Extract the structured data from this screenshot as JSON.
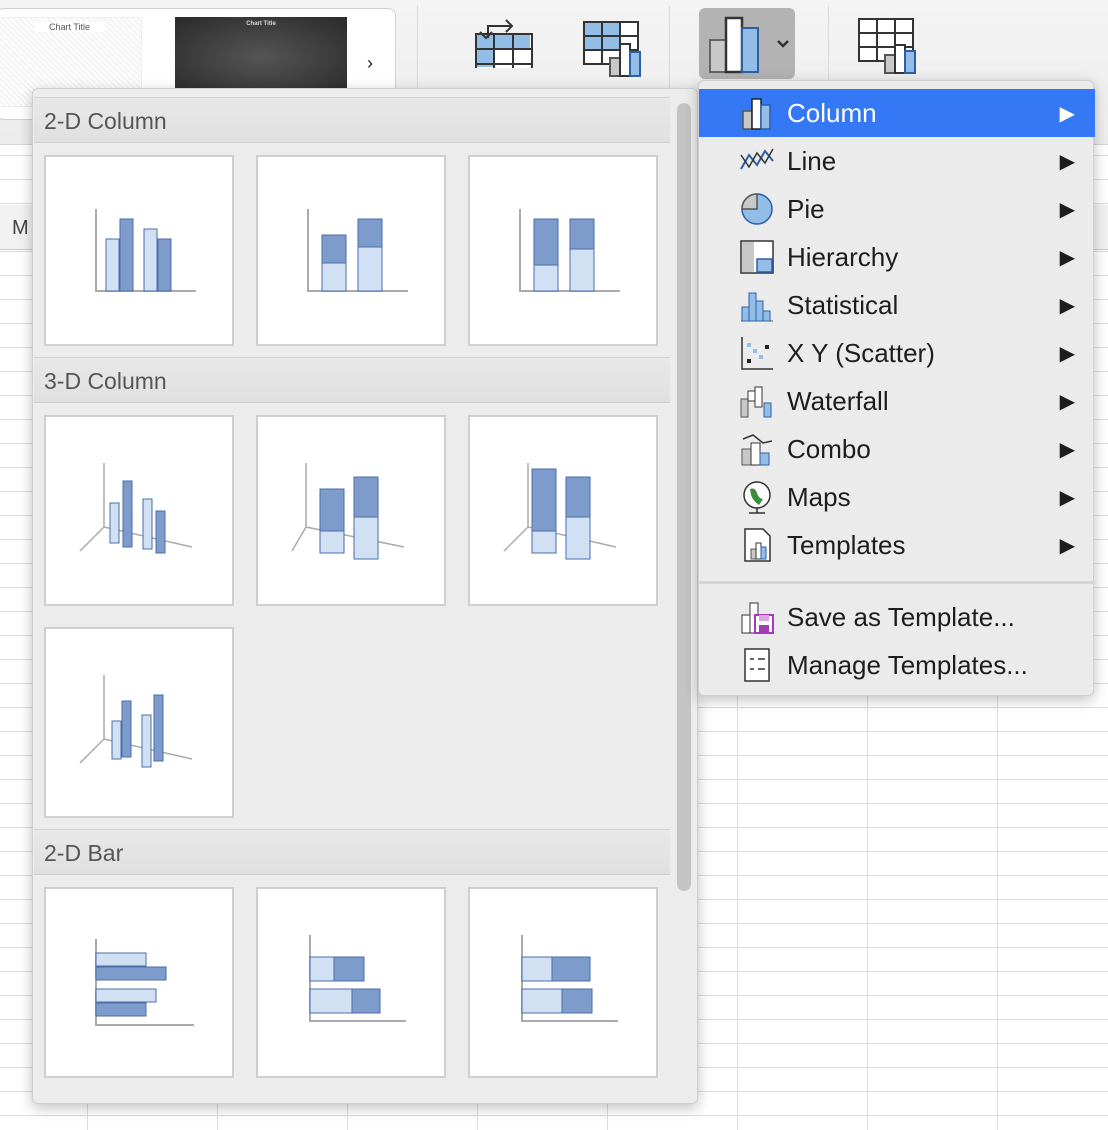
{
  "ribbon": {
    "style_gallery": {
      "thumbs": [
        {
          "title": "Chart Title"
        },
        {
          "title": "Chart Title"
        }
      ],
      "next_icon": "chevron-right-icon"
    },
    "buttons": [
      {
        "icon": "switch-row-column-icon"
      },
      {
        "icon": "select-data-icon"
      },
      {
        "icon": "change-chart-type-icon",
        "dropdown": true,
        "active": true
      },
      {
        "icon": "move-chart-icon"
      }
    ]
  },
  "sheet": {
    "visible_column": "M"
  },
  "gallery": {
    "sections": [
      {
        "title": "2-D Column",
        "items": [
          "clustered-column",
          "stacked-column",
          "100-stacked-column"
        ]
      },
      {
        "title": "3-D Column",
        "items": [
          "3d-clustered-column",
          "3d-stacked-column",
          "3d-100-stacked-column",
          "3d-column"
        ]
      },
      {
        "title": "2-D Bar",
        "items": [
          "clustered-bar",
          "stacked-bar",
          "100-stacked-bar"
        ]
      }
    ]
  },
  "menu": {
    "accent": "#3478f6",
    "items": [
      {
        "label": "Column",
        "icon": "column-chart-icon",
        "submenu": true,
        "selected": true
      },
      {
        "label": "Line",
        "icon": "line-chart-icon",
        "submenu": true
      },
      {
        "label": "Pie",
        "icon": "pie-chart-icon",
        "submenu": true
      },
      {
        "label": "Hierarchy",
        "icon": "hierarchy-chart-icon",
        "submenu": true
      },
      {
        "label": "Statistical",
        "icon": "statistical-chart-icon",
        "submenu": true
      },
      {
        "label": "X Y (Scatter)",
        "icon": "scatter-chart-icon",
        "submenu": true
      },
      {
        "label": "Waterfall",
        "icon": "waterfall-chart-icon",
        "submenu": true
      },
      {
        "label": "Combo",
        "icon": "combo-chart-icon",
        "submenu": true
      },
      {
        "label": "Maps",
        "icon": "map-chart-icon",
        "submenu": true
      },
      {
        "label": "Templates",
        "icon": "templates-icon",
        "submenu": true
      }
    ],
    "actions": [
      {
        "label": "Save as Template...",
        "icon": "save-template-icon"
      },
      {
        "label": "Manage Templates...",
        "icon": "manage-templates-icon"
      }
    ]
  }
}
